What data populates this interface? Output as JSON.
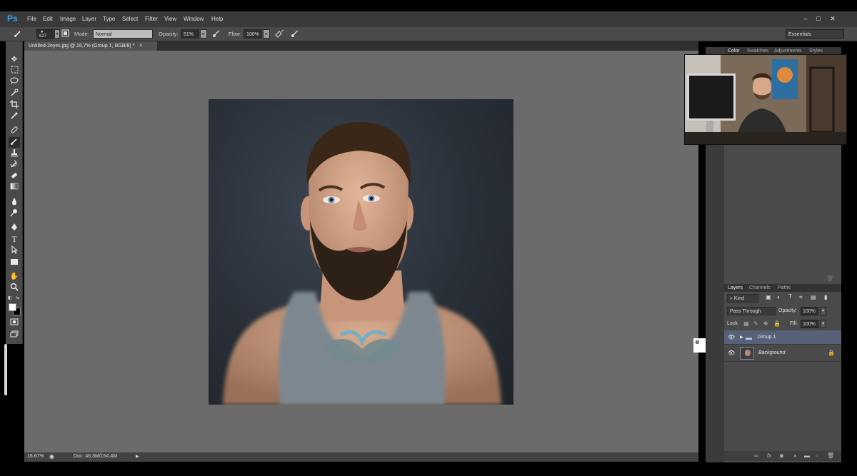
{
  "app": {
    "logo": "Ps"
  },
  "menu": [
    "File",
    "Edit",
    "Image",
    "Layer",
    "Type",
    "Select",
    "Filter",
    "View",
    "Window",
    "Help"
  ],
  "window_controls": {
    "minimize": "–",
    "maximize": "□",
    "close": "✕"
  },
  "options": {
    "brush_size": "627",
    "mode_label": "Mode:",
    "mode_value": "Normal",
    "opacity_label": "Opacity:",
    "opacity_value": "51%",
    "flow_label": "Flow:",
    "flow_value": "100%",
    "workspace": "Essentials"
  },
  "document_tab": {
    "title": "Untitled-2eyes.jpg @ 16,7% (Group 1, RGB/8) *",
    "close": "×"
  },
  "status": {
    "zoom": "16,67%",
    "doc": "Doc: 46,3M/154,4M"
  },
  "color_panel": {
    "tabs": [
      "Color",
      "Swatches",
      "Adjustments",
      "Styles"
    ],
    "active": "Color"
  },
  "layers_panel": {
    "tabs": [
      "Layers",
      "Channels",
      "Paths"
    ],
    "kind_label": "Kind",
    "blend_mode": "Pass Through",
    "opacity_label": "Opacity:",
    "opacity_value": "100%",
    "lock_label": "Lock:",
    "fill_label": "Fill:",
    "fill_value": "100%",
    "layers": [
      {
        "name": "Group 1",
        "type": "group",
        "selected": true
      },
      {
        "name": "Background",
        "type": "image",
        "locked": true,
        "selected": false
      }
    ]
  },
  "colors": {
    "accent_selection": "#57627a",
    "ps_blue": "#3fa2e8",
    "canvas_bg": "#6b6b6b"
  }
}
